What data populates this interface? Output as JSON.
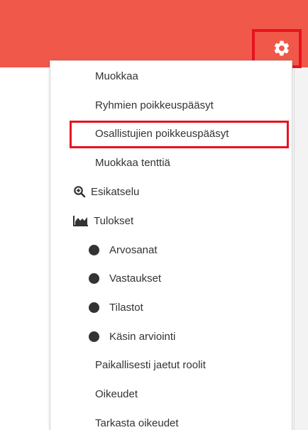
{
  "header": {
    "accent_color": "#f0584a",
    "highlight_color": "#e8131f",
    "settings_icon": "gear-icon"
  },
  "menu": {
    "items": [
      {
        "label": "Muokkaa"
      },
      {
        "label": "Ryhmien poikkeuspääsyt"
      },
      {
        "label": "Osallistujien poikkeuspääsyt",
        "highlighted": true
      },
      {
        "label": "Muokkaa tenttiä"
      },
      {
        "label": "Esikatselu",
        "icon": "zoom-in-icon"
      },
      {
        "label": "Tulokset",
        "icon": "area-chart-icon"
      },
      {
        "label": "Arvosanat",
        "icon": "bullet-icon"
      },
      {
        "label": "Vastaukset",
        "icon": "bullet-icon"
      },
      {
        "label": "Tilastot",
        "icon": "bullet-icon"
      },
      {
        "label": "Käsin arviointi",
        "icon": "bullet-icon"
      },
      {
        "label": "Paikallisesti jaetut roolit"
      },
      {
        "label": "Oikeudet"
      },
      {
        "label": "Tarkasta oikeudet"
      }
    ]
  }
}
